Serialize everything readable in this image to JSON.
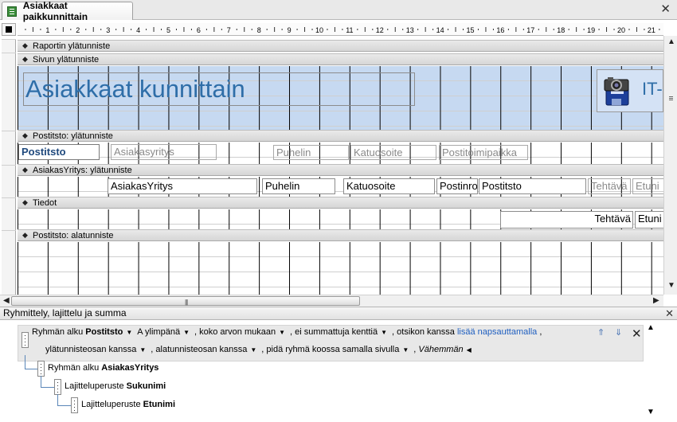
{
  "window": {
    "tab_title": "Asiakkaat paikkunnittain",
    "close_glyph": "✕"
  },
  "ruler": {
    "numbers": [
      "1",
      "2",
      "3",
      "4",
      "5",
      "6",
      "7",
      "8",
      "9",
      "10",
      "11",
      "12",
      "13",
      "14",
      "15",
      "16",
      "17",
      "18",
      "19",
      "20",
      "21"
    ]
  },
  "bands": {
    "report_header": "Raportin ylätunniste",
    "page_header": "Sivun ylätunniste",
    "postitsto_header": "Postitsto: ylätunniste",
    "asiakasyritys_header": "AsiakasYritys: ylätunniste",
    "detail": "Tiedot",
    "postitsto_footer": "Postitsto: alatunniste"
  },
  "page_header": {
    "title": "Asiakkaat kunnittain",
    "logo_text": "IT-"
  },
  "postitsto_header": {
    "field": "Postitsto",
    "labels": [
      "Asiakasyritys",
      "Puhelin",
      "Katuosoite",
      "Postitoimipaikka"
    ]
  },
  "asiakasyritys_header": {
    "fields": [
      "AsiakasYritys",
      "Puhelin",
      "Katuosoite",
      "Postinro",
      "Postitsto"
    ],
    "labels": [
      "Tehtävä",
      "Etuni"
    ]
  },
  "detail": {
    "fields": [
      "Tehtävä",
      "Etuni"
    ]
  },
  "group_pane": {
    "title": "Ryhmittely, lajittelu ja summa",
    "row1": {
      "prefix": "Ryhmän alku",
      "field": "Postitsto",
      "order": "A ylimpänä",
      "scope": "koko arvon mukaan",
      "totals": "ei summattuja kenttiä",
      "title_prefix": "otsikon kanssa",
      "title_link": "lisää napsauttamalla",
      "comma": ","
    },
    "row1b": {
      "header": "ylätunnisteosan kanssa",
      "footer": "alatunnisteosan kanssa",
      "keep": "pidä ryhmä koossa samalla sivulla",
      "less": "Vähemmän"
    },
    "row2": {
      "prefix": "Ryhmän alku",
      "field": "AsiakasYritys"
    },
    "row3": {
      "prefix": "Lajitteluperuste",
      "field": "Sukunimi"
    },
    "row4": {
      "prefix": "Lajitteluperuste",
      "field": "Etunimi"
    }
  },
  "colors": {
    "page_header_bg": "#c6d9f1",
    "title_text": "#2f6ea8",
    "link": "#1f5fc0"
  }
}
